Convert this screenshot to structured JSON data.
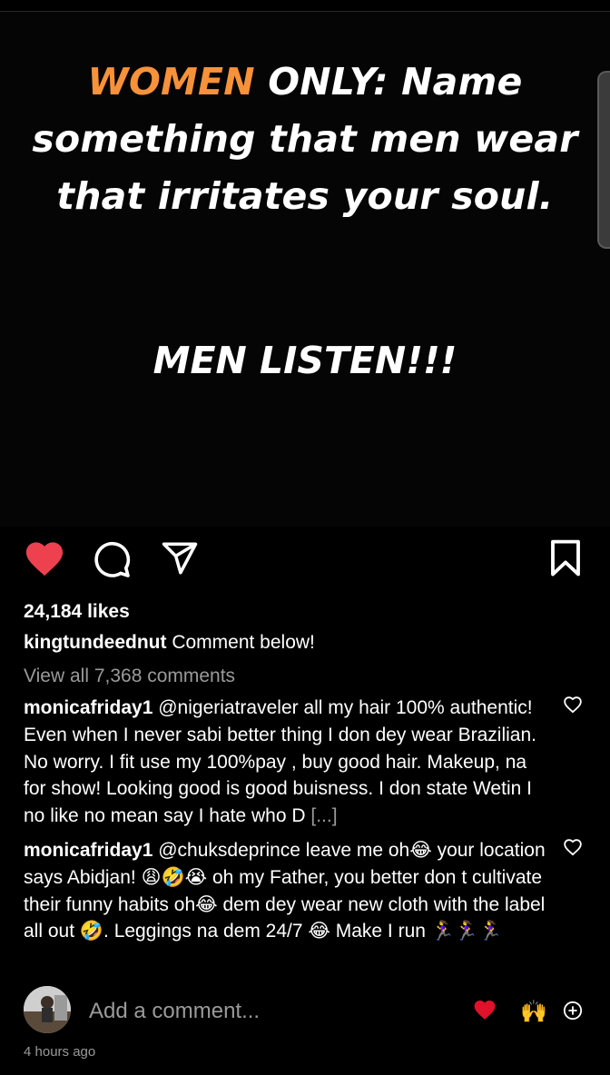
{
  "post": {
    "headline_accent": "WOMEN",
    "headline_rest": "ONLY: Name something that men wear that irritates your soul.",
    "headline_sub": "MEN LISTEN!!!"
  },
  "actions": {
    "like_icon": "heart-filled-icon",
    "comment_icon": "comment-bubble-icon",
    "share_icon": "paper-plane-icon",
    "save_icon": "bookmark-icon",
    "like_color": "#ee4150"
  },
  "likes": "24,184 likes",
  "caption": {
    "username": "kingtundeednut",
    "text": "Comment below!"
  },
  "view_all": "View all 7,368 comments",
  "comments": [
    {
      "username": "monicafriday1",
      "text": "@nigeriatraveler all my hair 100% authentic! Even when I never sabi better thing I don dey wear Brazilian. No worry. I fit use my 100%pay , buy good hair. Makeup, na for show! Looking good is good buisness. I don state Wetin I no like no mean say I hate who D",
      "more": "[...]"
    },
    {
      "username": "monicafriday1",
      "text": "@chuksdeprince leave me oh😂 your location says Abidjan! 😩🤣😭 oh my Father, you better don t cultivate their funny habits oh😂 dem dey wear new cloth with the label all out 🤣. Leggings na dem 24/7 😂 Make I run 🏃‍♀️🏃‍♀️🏃‍♀️"
    }
  ],
  "add_comment": {
    "placeholder": "Add a comment...",
    "quick_emoji_1": "❤️",
    "quick_emoji_2": "🙌",
    "plus_icon": "add-circle-icon"
  },
  "timestamp": "4 hours ago"
}
